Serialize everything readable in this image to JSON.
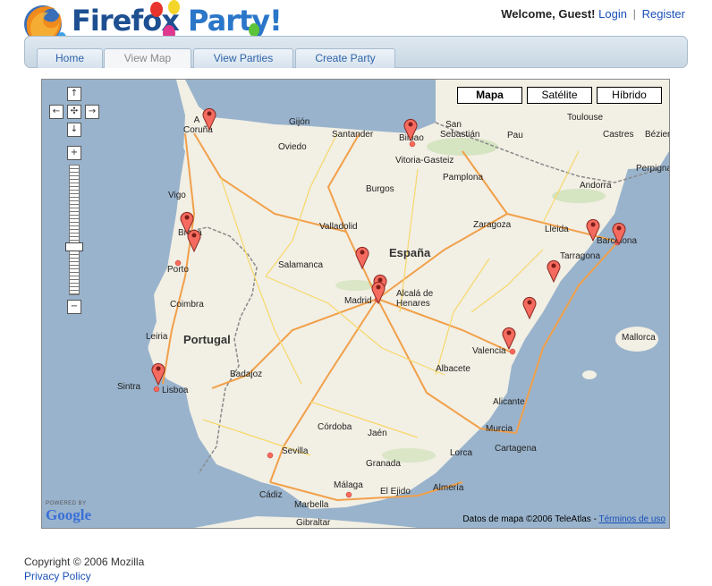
{
  "brand": {
    "logo_text_1": "Firefox",
    "logo_text_2": "Party!",
    "accent": "#2a76c9"
  },
  "user_bar": {
    "welcome": "Welcome, Guest!",
    "login": "Login",
    "separator": "|",
    "register": "Register"
  },
  "nav": {
    "tabs": [
      {
        "label": "Home",
        "active": false
      },
      {
        "label": "View Map",
        "active": true
      },
      {
        "label": "View Parties",
        "active": false
      },
      {
        "label": "Create Party",
        "active": false
      }
    ]
  },
  "map": {
    "types": [
      "Mapa",
      "Satélite",
      "Híbrido"
    ],
    "selected_type": "Mapa",
    "controls": {
      "pan_up": "↑",
      "pan_left": "←",
      "pan_center": "✣",
      "pan_right": "→",
      "pan_down": "↓",
      "zoom_in": "+",
      "zoom_out": "−"
    },
    "powered_by": "POWERED BY",
    "powered_by_brand": "Google",
    "attribution": "Datos de mapa ©2006 TeleAtlas -",
    "terms_link": "Términos de uso",
    "countries": [
      "España",
      "Portugal"
    ],
    "cities": [
      "A Coruña",
      "Gijón",
      "Oviedo",
      "Santander",
      "Bilbao",
      "San Sebastián",
      "Toulouse",
      "Pau",
      "Castres",
      "Béziers",
      "Perpignan",
      "Vitoria-Gasteiz",
      "Pamplona",
      "Andorra",
      "Vigo",
      "Burgos",
      "Valladolid",
      "Zaragoza",
      "Lleida",
      "Barcelona",
      "Tarragona",
      "Braga",
      "Porto",
      "Salamanca",
      "Madrid",
      "Alcalá de Henares",
      "Coimbra",
      "Leiria",
      "Mallorca",
      "Valencia",
      "Badajoz",
      "Albacete",
      "Sintra",
      "Lisboa",
      "Alicante",
      "Córdoba",
      "Jaén",
      "Murcia",
      "Cartagena",
      "Sevilla",
      "Granada",
      "Lorca",
      "Almería",
      "El Ejido",
      "Cádiz",
      "Málaga",
      "Marbella",
      "Gibraltar"
    ],
    "markers": 12
  },
  "footer": {
    "copyright": "Copyright © 2006 Mozilla",
    "privacy": "Privacy Policy"
  }
}
